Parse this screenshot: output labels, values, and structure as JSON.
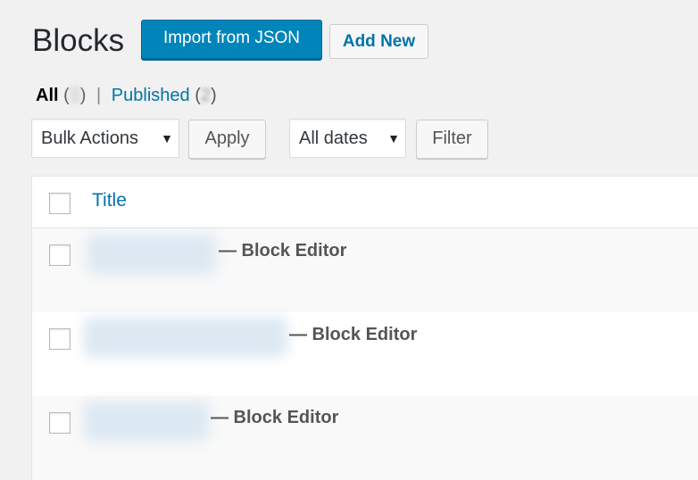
{
  "header": {
    "title": "Blocks",
    "import_button": "Import from JSON",
    "add_new_button": "Add New"
  },
  "filters": {
    "all_label": "All",
    "paren_open": "(",
    "paren_close": ")",
    "separator": "|",
    "published_label": "Published",
    "published_count_visible": "2"
  },
  "bulk": {
    "selected": "Bulk Actions",
    "apply_label": "Apply"
  },
  "dates": {
    "selected": "All dates",
    "filter_label": "Filter"
  },
  "table": {
    "column_title": "Title",
    "rows": [
      {
        "title": "— Block Editor"
      },
      {
        "title": "— Block Editor"
      },
      {
        "title": "— Block Editor"
      }
    ]
  },
  "icons": {
    "dropdown": "▼"
  },
  "colors": {
    "primary": "#0085ba",
    "link": "#0073aa",
    "background": "#f1f1f1"
  }
}
